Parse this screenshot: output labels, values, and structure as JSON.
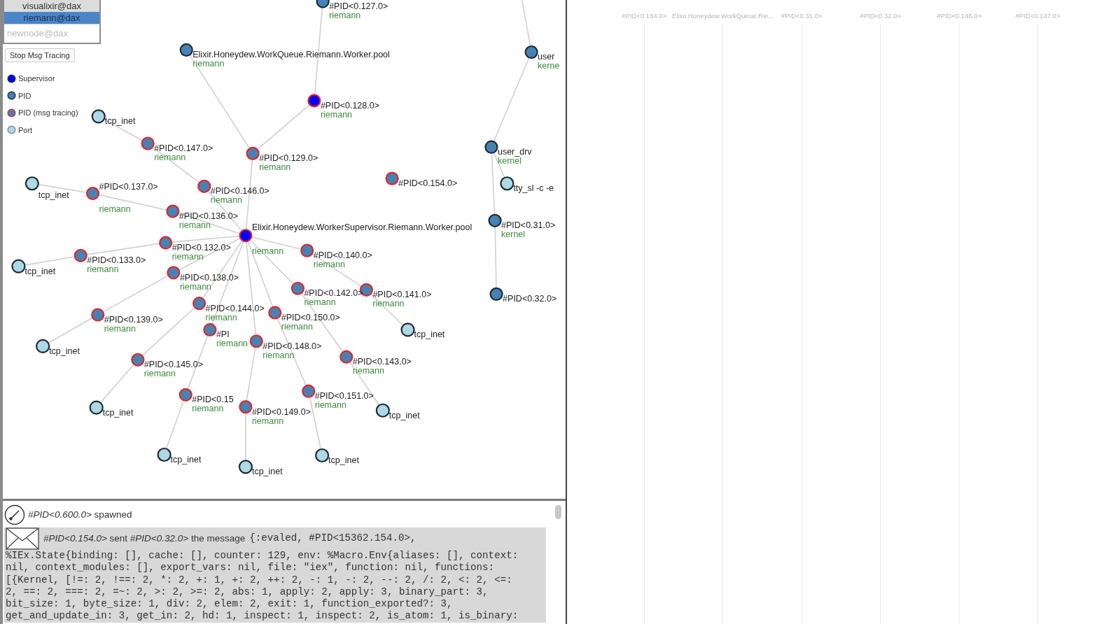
{
  "node_selector": {
    "nodes": [
      {
        "label": "visualixir@dax",
        "selected": false
      },
      {
        "label": "riemann@dax",
        "selected": true
      }
    ],
    "input": {
      "placeholder": "newnode@dax"
    }
  },
  "trace_button": {
    "label": "Stop Msg Tracing"
  },
  "legend": [
    {
      "label": "Supervisor",
      "kind": "supervisor",
      "traced": false
    },
    {
      "label": "PID",
      "kind": "pid",
      "traced": false
    },
    {
      "label": "PID (msg tracing)",
      "kind": "pid",
      "traced": true
    },
    {
      "label": "Port",
      "kind": "port",
      "traced": false
    }
  ],
  "graph": {
    "trees": [
      {
        "label": "#PID<0.127.0>",
        "sublabel": "riemann",
        "kind": "pid",
        "traced": false,
        "children": [
          {
            "label": "#PID<0.128.0>",
            "sublabel": "riemann",
            "kind": "supervisor",
            "traced": true,
            "children": [
              {
                "label": "#PID<0.129.0>",
                "sublabel": "riemann",
                "kind": "pid",
                "traced": true,
                "children": [
                  {
                    "label": "Elixir.Honeydew.WorkQueue.Riemann.Worker.pool",
                    "sublabel": "riemann",
                    "kind": "pid",
                    "traced": false
                  },
                  {
                    "label": "Elixir.Honeydew.WorkerSupervisor.Riemann.Worker.pool",
                    "sublabel": "riemann",
                    "kind": "supervisor",
                    "traced": true,
                    "children": [
                      {
                        "label": "#PID<0.146.0>",
                        "sublabel": "riemann",
                        "kind": "pid",
                        "traced": true,
                        "children": [
                          {
                            "label": "#PID<0.147.0>",
                            "sublabel": "riemann",
                            "kind": "pid",
                            "traced": true,
                            "children": [
                              {
                                "label": "tcp_inet",
                                "kind": "port",
                                "traced": false
                              }
                            ]
                          }
                        ]
                      },
                      {
                        "label": "#PID<0.136.0>",
                        "sublabel": "riemann",
                        "kind": "pid",
                        "traced": true,
                        "children": [
                          {
                            "label": "#PID<0.137.0>",
                            "sublabel": "riemann",
                            "kind": "pid",
                            "traced": true,
                            "children": [
                              {
                                "label": "tcp_inet",
                                "kind": "port",
                                "traced": false
                              }
                            ]
                          }
                        ]
                      },
                      {
                        "label": "#PID<0.132.0>",
                        "sublabel": "riemann",
                        "kind": "pid",
                        "traced": true,
                        "children": [
                          {
                            "label": "#PID<0.133.0>",
                            "sublabel": "riemann",
                            "kind": "pid",
                            "traced": true,
                            "children": [
                              {
                                "label": "tcp_inet",
                                "kind": "port",
                                "traced": false
                              }
                            ]
                          }
                        ]
                      },
                      {
                        "label": "#PID<0.140.0>",
                        "sublabel": "riemann",
                        "kind": "pid",
                        "traced": true,
                        "children": [
                          {
                            "label": "#PID<0.141.0>",
                            "sublabel": "riemann",
                            "kind": "pid",
                            "traced": true,
                            "children": [
                              {
                                "label": "tcp_inet",
                                "kind": "port",
                                "traced": false
                              }
                            ]
                          }
                        ]
                      },
                      {
                        "label": "#PID<0.138.0>",
                        "sublabel": "riemann",
                        "kind": "pid",
                        "traced": true,
                        "children": [
                          {
                            "label": "#PID<0.139.0>",
                            "sublabel": "riemann",
                            "kind": "pid",
                            "traced": true,
                            "children": [
                              {
                                "label": "tcp_inet",
                                "kind": "port",
                                "traced": false
                              }
                            ]
                          }
                        ]
                      },
                      {
                        "label": "#PID<0.144.0>",
                        "sublabel": "riemann",
                        "kind": "pid",
                        "traced": true,
                        "children": [
                          {
                            "label": "#PID<0.145.0>",
                            "sublabel": "riemann",
                            "kind": "pid",
                            "traced": true,
                            "children": [
                              {
                                "label": "tcp_inet",
                                "kind": "port",
                                "traced": false
                              }
                            ]
                          }
                        ]
                      },
                      {
                        "label": "#PID<0.142.0>",
                        "sublabel": "riemann",
                        "kind": "pid",
                        "traced": true,
                        "children": [
                          {
                            "label": "#PID<0.143.0>",
                            "sublabel": "riemann",
                            "kind": "pid",
                            "traced": true,
                            "children": [
                              {
                                "label": "tcp_inet",
                                "kind": "port",
                                "traced": false
                              }
                            ]
                          }
                        ]
                      },
                      {
                        "label": "#PI",
                        "sublabel": "riemann",
                        "kind": "pid",
                        "traced": true,
                        "children": [
                          {
                            "label": "#PID<0.15",
                            "sublabel": "riemann",
                            "kind": "pid",
                            "traced": true,
                            "children": [
                              {
                                "label": "tcp_inet",
                                "kind": "port",
                                "traced": false
                              }
                            ]
                          }
                        ]
                      },
                      {
                        "label": "#PID<0.148.0>",
                        "sublabel": "riemann",
                        "kind": "pid",
                        "traced": true,
                        "children": [
                          {
                            "label": "#PID<0.149.0>",
                            "sublabel": "riemann",
                            "kind": "pid",
                            "traced": true,
                            "children": [
                              {
                                "label": "tcp_inet",
                                "kind": "port",
                                "traced": false
                              }
                            ]
                          }
                        ]
                      },
                      {
                        "label": "#PID<0.150.0>",
                        "sublabel": "riemann",
                        "kind": "pid",
                        "traced": true,
                        "children": [
                          {
                            "label": "#PID<0.151.0>",
                            "sublabel": "riemann",
                            "kind": "pid",
                            "traced": true,
                            "children": [
                              {
                                "label": "tcp_inet",
                                "kind": "port",
                                "traced": false
                              }
                            ]
                          }
                        ]
                      }
                    ]
                  }
                ]
              }
            ]
          }
        ]
      },
      {
        "label": "user",
        "sublabel": "kerne",
        "kind": "pid",
        "traced": false,
        "children": [
          {
            "label": "user_drv",
            "sublabel": "kernel",
            "kind": "pid",
            "traced": false,
            "children": [
              {
                "label": "tty_sl -c -e",
                "kind": "port",
                "traced": false
              },
              {
                "label": "#PID<0.31.0>",
                "sublabel": "kernel",
                "kind": "pid",
                "traced": false,
                "children": [
                  {
                    "label": "#PID<0.32.0>",
                    "kind": "pid",
                    "traced": false
                  }
                ]
              }
            ]
          }
        ]
      },
      {
        "label": "#PID<0.154.0>",
        "kind": "pid",
        "traced": true
      }
    ]
  },
  "log": [
    {
      "kind": "spawn",
      "text": "*#PID<0.600.0>* spawned"
    },
    {
      "kind": "message",
      "text": "*#PID<0.154.0>* sent *#PID<0.32.0>* the message",
      "message_lines": [
        "{:evaled, #PID<15362.154.0>,",
        "%IEx.State{binding: [], cache: [], counter: 129, env: %Macro.Env{aliases: [], context:",
        "nil, context_modules: [], export_vars: nil, file: \"iex\", function: nil, functions:",
        "[{Kernel, [!=: 2, !==: 2, *: 2, +: 1, +: 2, ++: 2, -: 1, -: 2, --: 2, /: 2, <: 2, <=:",
        "2, ==: 2, ===: 2, =~: 2, >: 2, >=: 2, abs: 1, apply: 2, apply: 3, binary_part: 3,",
        "bit_size: 1, byte_size: 1, div: 2, elem: 2, exit: 1, function_exported?: 3,",
        "get_and_update_in: 3, get_in: 2, hd: 1, inspect: 1, inspect: 2, is_atom: 1, is_binary:"
      ]
    }
  ],
  "sequence": {
    "columns": [
      {
        "label": "#PID<0.154.0>"
      },
      {
        "label": "Elixir.Honeydew.WorkQueue.Rie..."
      },
      {
        "label": "#PID<0.31.0>"
      },
      {
        "label": "#PID<0.32.0>"
      },
      {
        "label": "#PID<0.146.0>"
      },
      {
        "label": "#PID<0.147.0>"
      }
    ]
  }
}
